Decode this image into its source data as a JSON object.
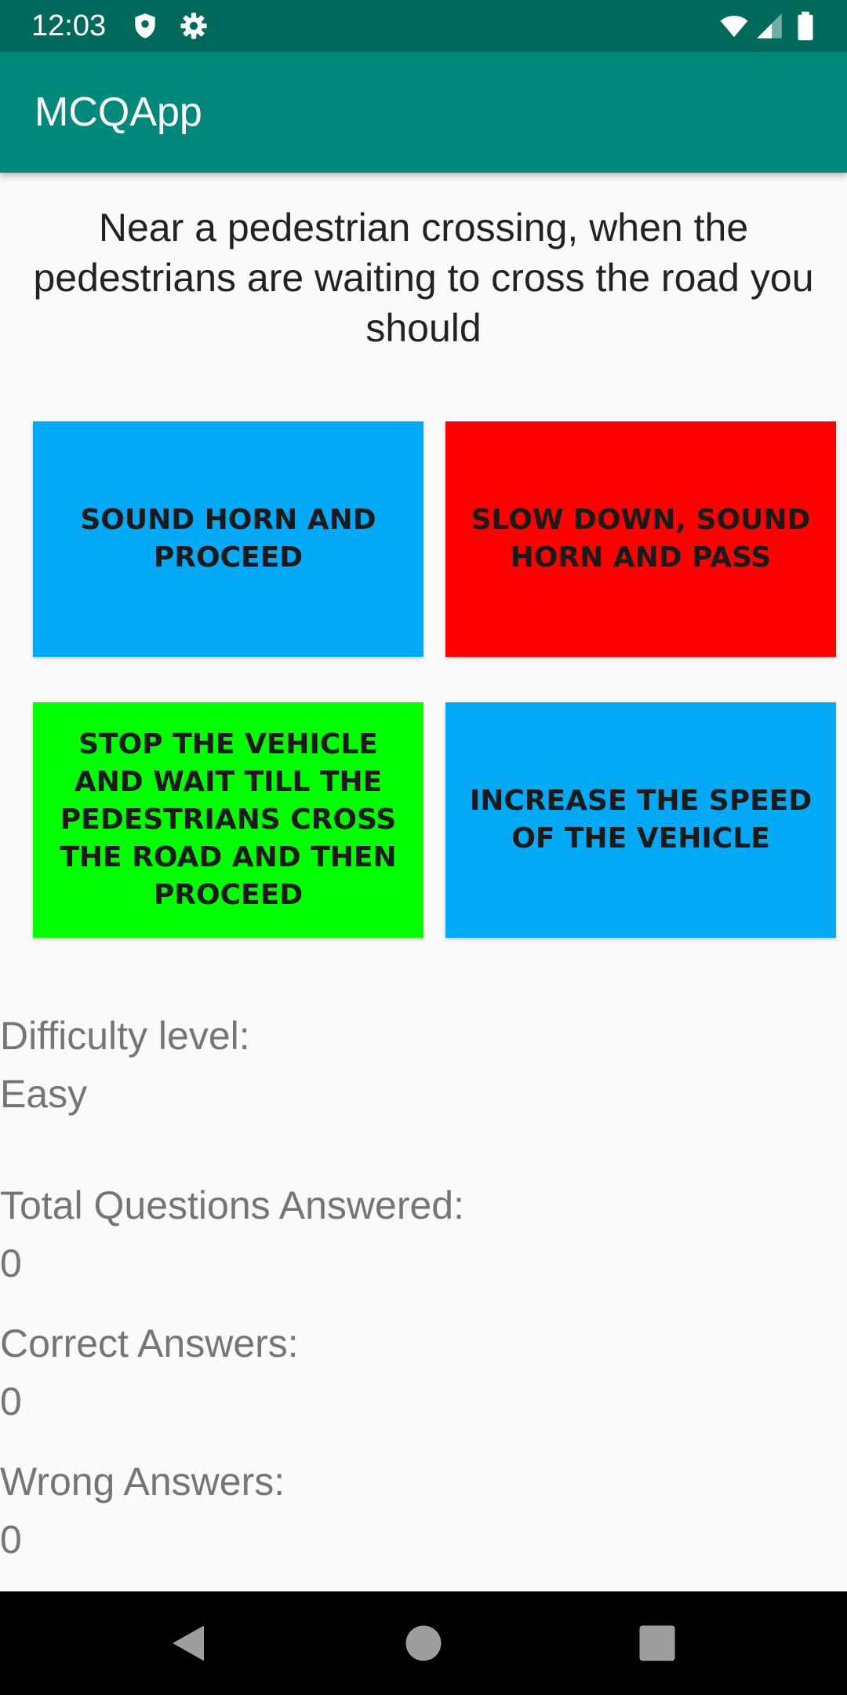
{
  "status_bar": {
    "time": "12:03",
    "icons": [
      "shield-icon",
      "gear-icon",
      "wifi-icon",
      "cellular-signal-icon",
      "battery-icon"
    ]
  },
  "app_bar": {
    "title": "MCQApp",
    "color": "#00897b"
  },
  "question": {
    "text": "Near a pedestrian crossing, when the pedestrians are waiting to cross the road you should"
  },
  "options": [
    {
      "label": "SOUND HORN AND PROCEED",
      "color": "#03a9f4"
    },
    {
      "label": "SLOW DOWN, SOUND HORN AND PASS",
      "color": "#ff0000"
    },
    {
      "label": "STOP THE VEHICLE AND WAIT TILL THE PEDESTRIANS CROSS THE ROAD AND THEN PROCEED",
      "color": "#00ff00"
    },
    {
      "label": "INCREASE THE SPEED OF THE VEHICLE",
      "color": "#03a9f4"
    }
  ],
  "stats": {
    "difficulty_label": "Difficulty level:",
    "difficulty_value": "Easy",
    "total_label": "Total Questions Answered:",
    "total_value": "0",
    "correct_label": "Correct Answers:",
    "correct_value": "0",
    "wrong_label": "Wrong Answers:",
    "wrong_value": "0"
  },
  "nav_bar": {
    "icons": [
      "back-icon",
      "home-icon",
      "recents-icon"
    ]
  }
}
